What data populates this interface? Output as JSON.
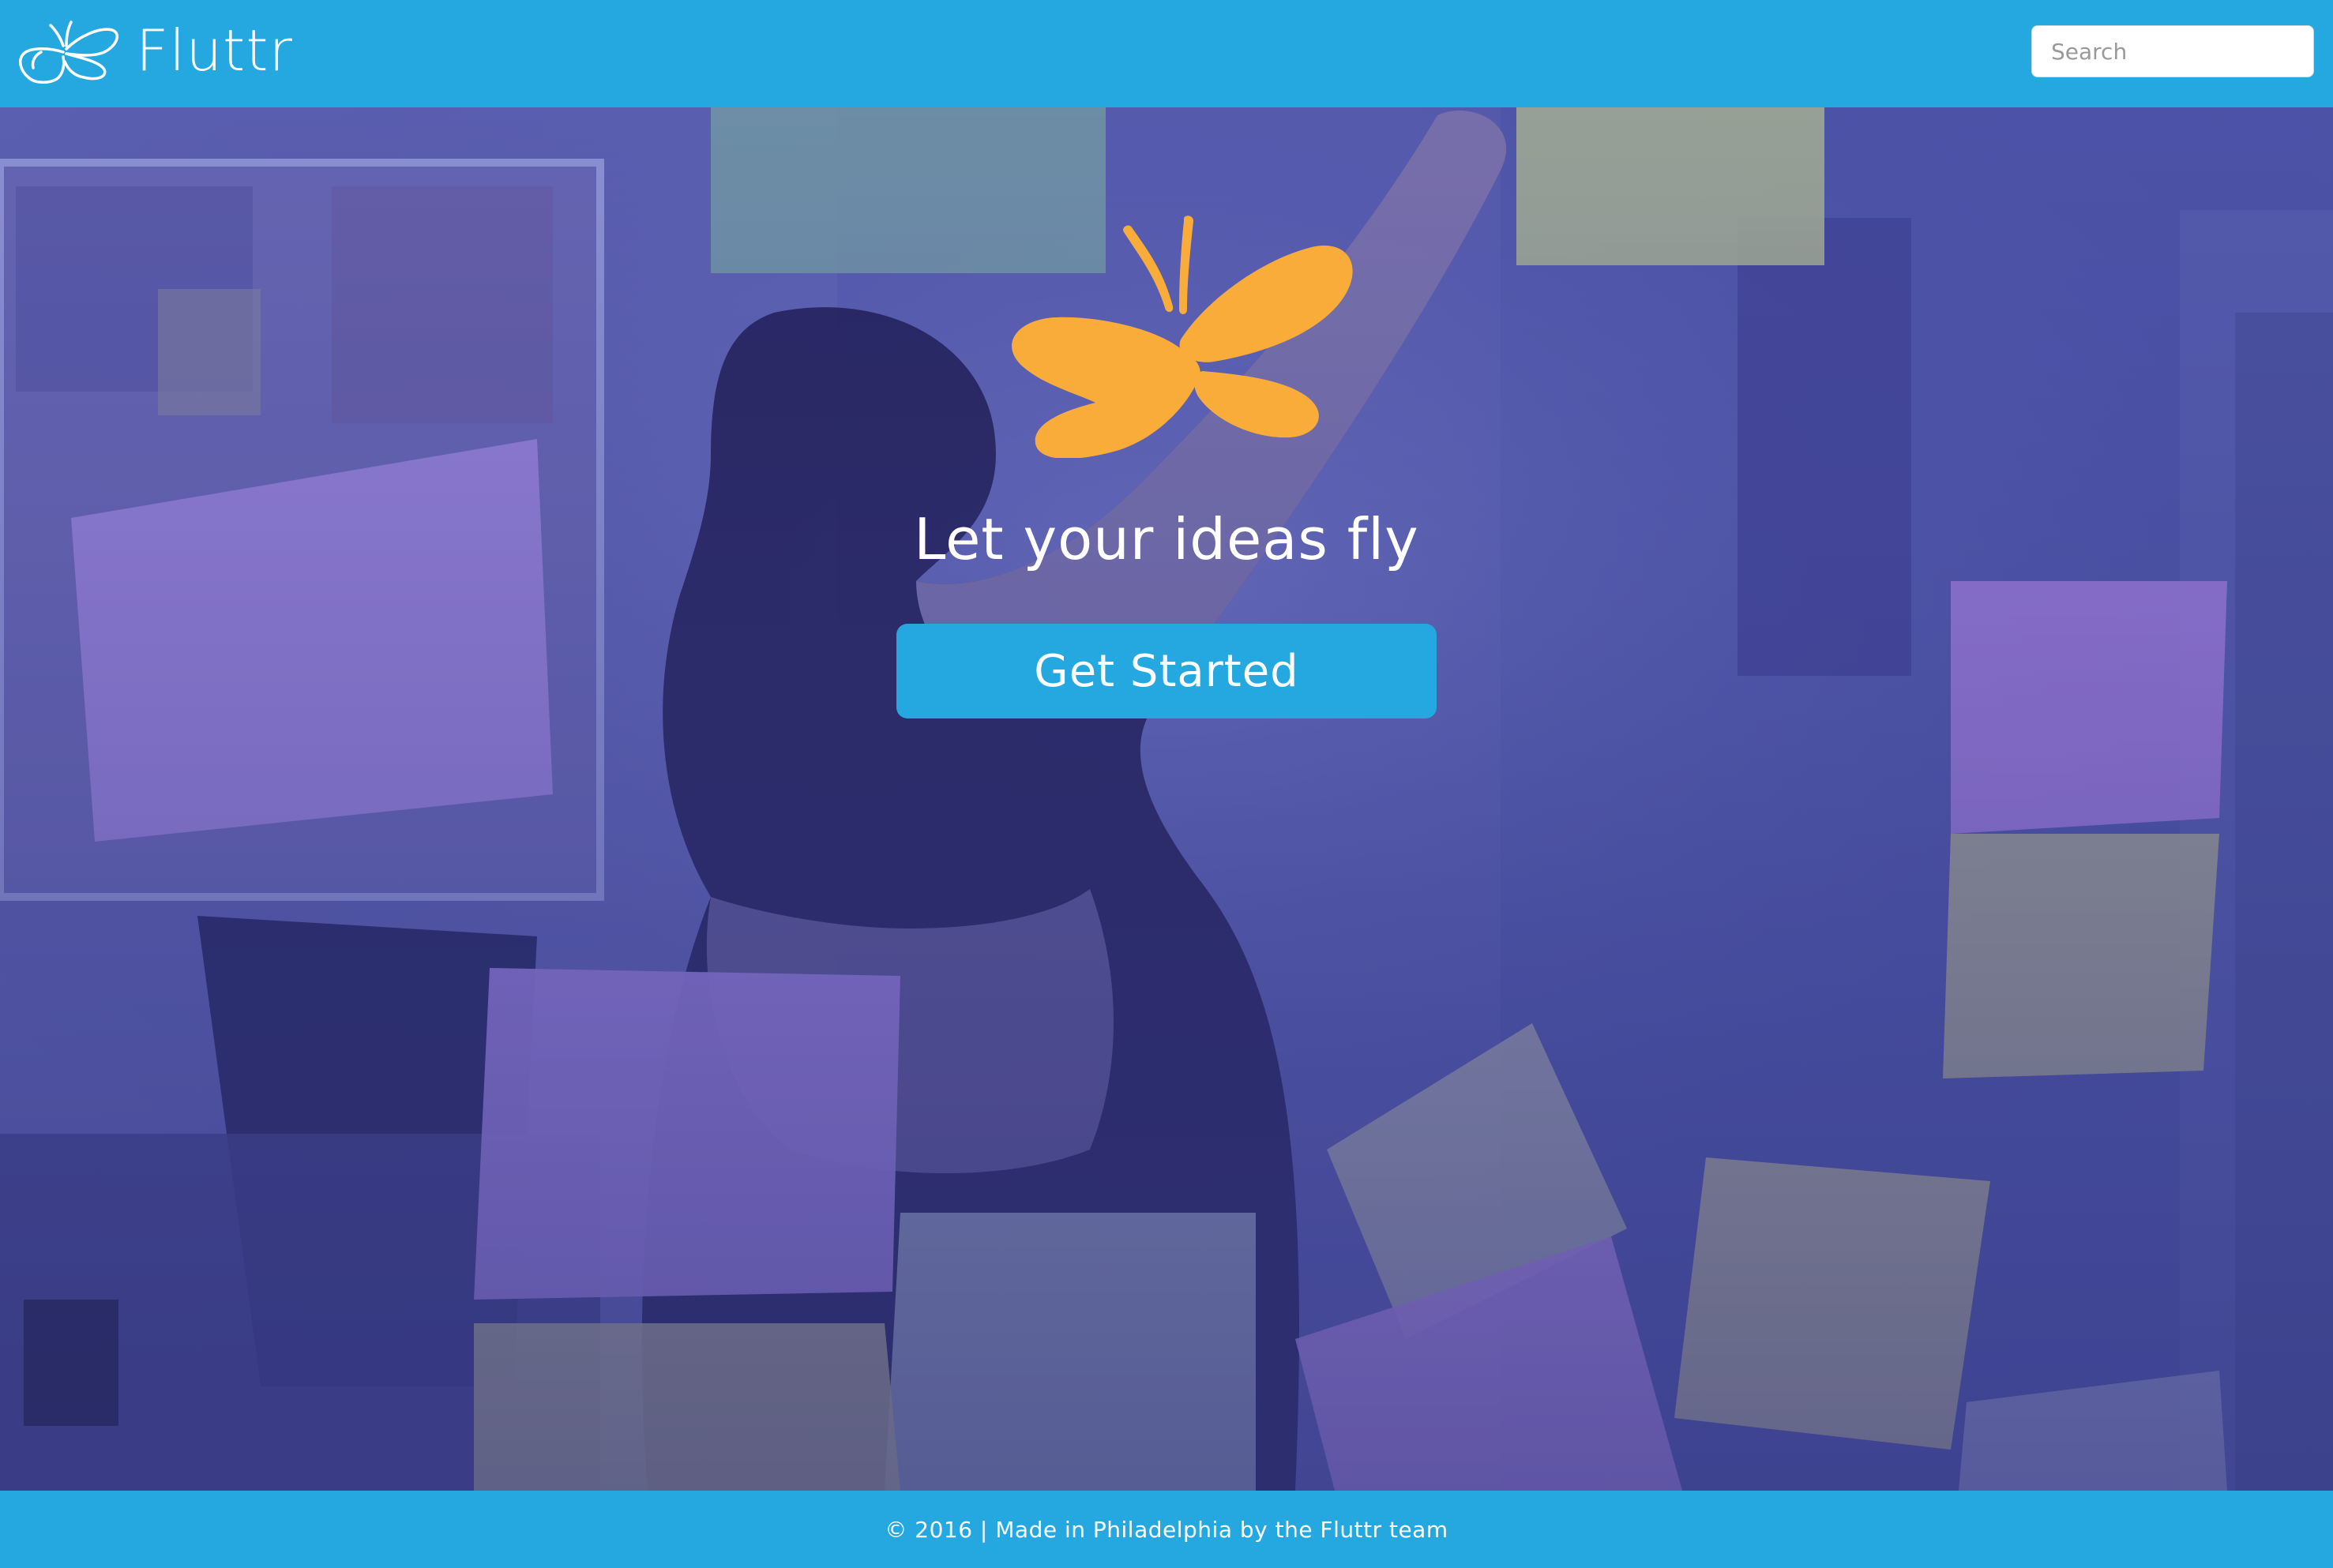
{
  "navbar": {
    "brand_name": "Fluttr",
    "brand_logo_icon": "butterfly-outline-icon",
    "search_placeholder": "Search",
    "search_value": ""
  },
  "hero": {
    "logo_icon": "butterfly-icon",
    "tagline": "Let your ideas fly",
    "cta_label": "Get Started",
    "background_image": "person-placing-sticky-notes-on-glass-wall"
  },
  "footer": {
    "text": "© 2016 | Made in Philadelphia by the Fluttr team"
  },
  "colors": {
    "primary_blue": "#25a8e0",
    "accent_orange": "#f9ac3a",
    "hero_tint": "#5a5eb0",
    "text_white": "#ffffff"
  }
}
